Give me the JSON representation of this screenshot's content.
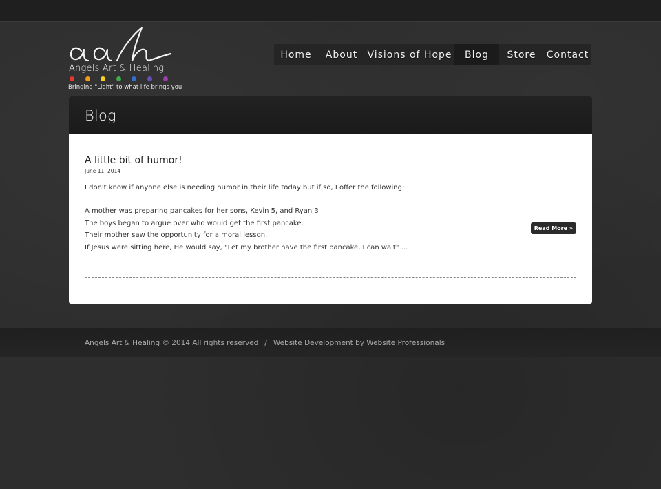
{
  "logo": {
    "monogram": "aah",
    "name": "Angels Art & Healing",
    "tagline": "Bringing \"Light\" to what life brings you",
    "dot_colors": [
      "#e23b2e",
      "#f39a1e",
      "#f6d21a",
      "#3fae49",
      "#2f6fd1",
      "#6a4fb3",
      "#9b3fb0"
    ]
  },
  "nav": {
    "items": [
      {
        "label": "Home",
        "active": false
      },
      {
        "label": "About",
        "active": false
      },
      {
        "label": "Visions of Hope",
        "active": false
      },
      {
        "label": "Blog",
        "active": true
      },
      {
        "label": "Store",
        "active": false
      },
      {
        "label": "Contact",
        "active": false
      }
    ]
  },
  "page": {
    "title": "Blog"
  },
  "post": {
    "title": "A little bit of humor!",
    "date": "June 11, 2014",
    "intro": "I don't know if anyone else is needing humor in their life today but if so, I offer the following:",
    "lines": [
      "A mother was preparing pancakes for her sons, Kevin 5, and Ryan 3",
      "The boys began to argue over who would get the first pancake.",
      "Their mother saw the opportunity for a moral lesson.",
      "If Jesus were sitting here, He would say, \"Let my brother have the first pancake, I can wait\" ..."
    ],
    "read_more": "Read More »"
  },
  "footer": {
    "copyright": "Angels Art & Healing © 2014 All rights reserved",
    "separator": "/",
    "credit": "Website Development by Website Professionals"
  }
}
